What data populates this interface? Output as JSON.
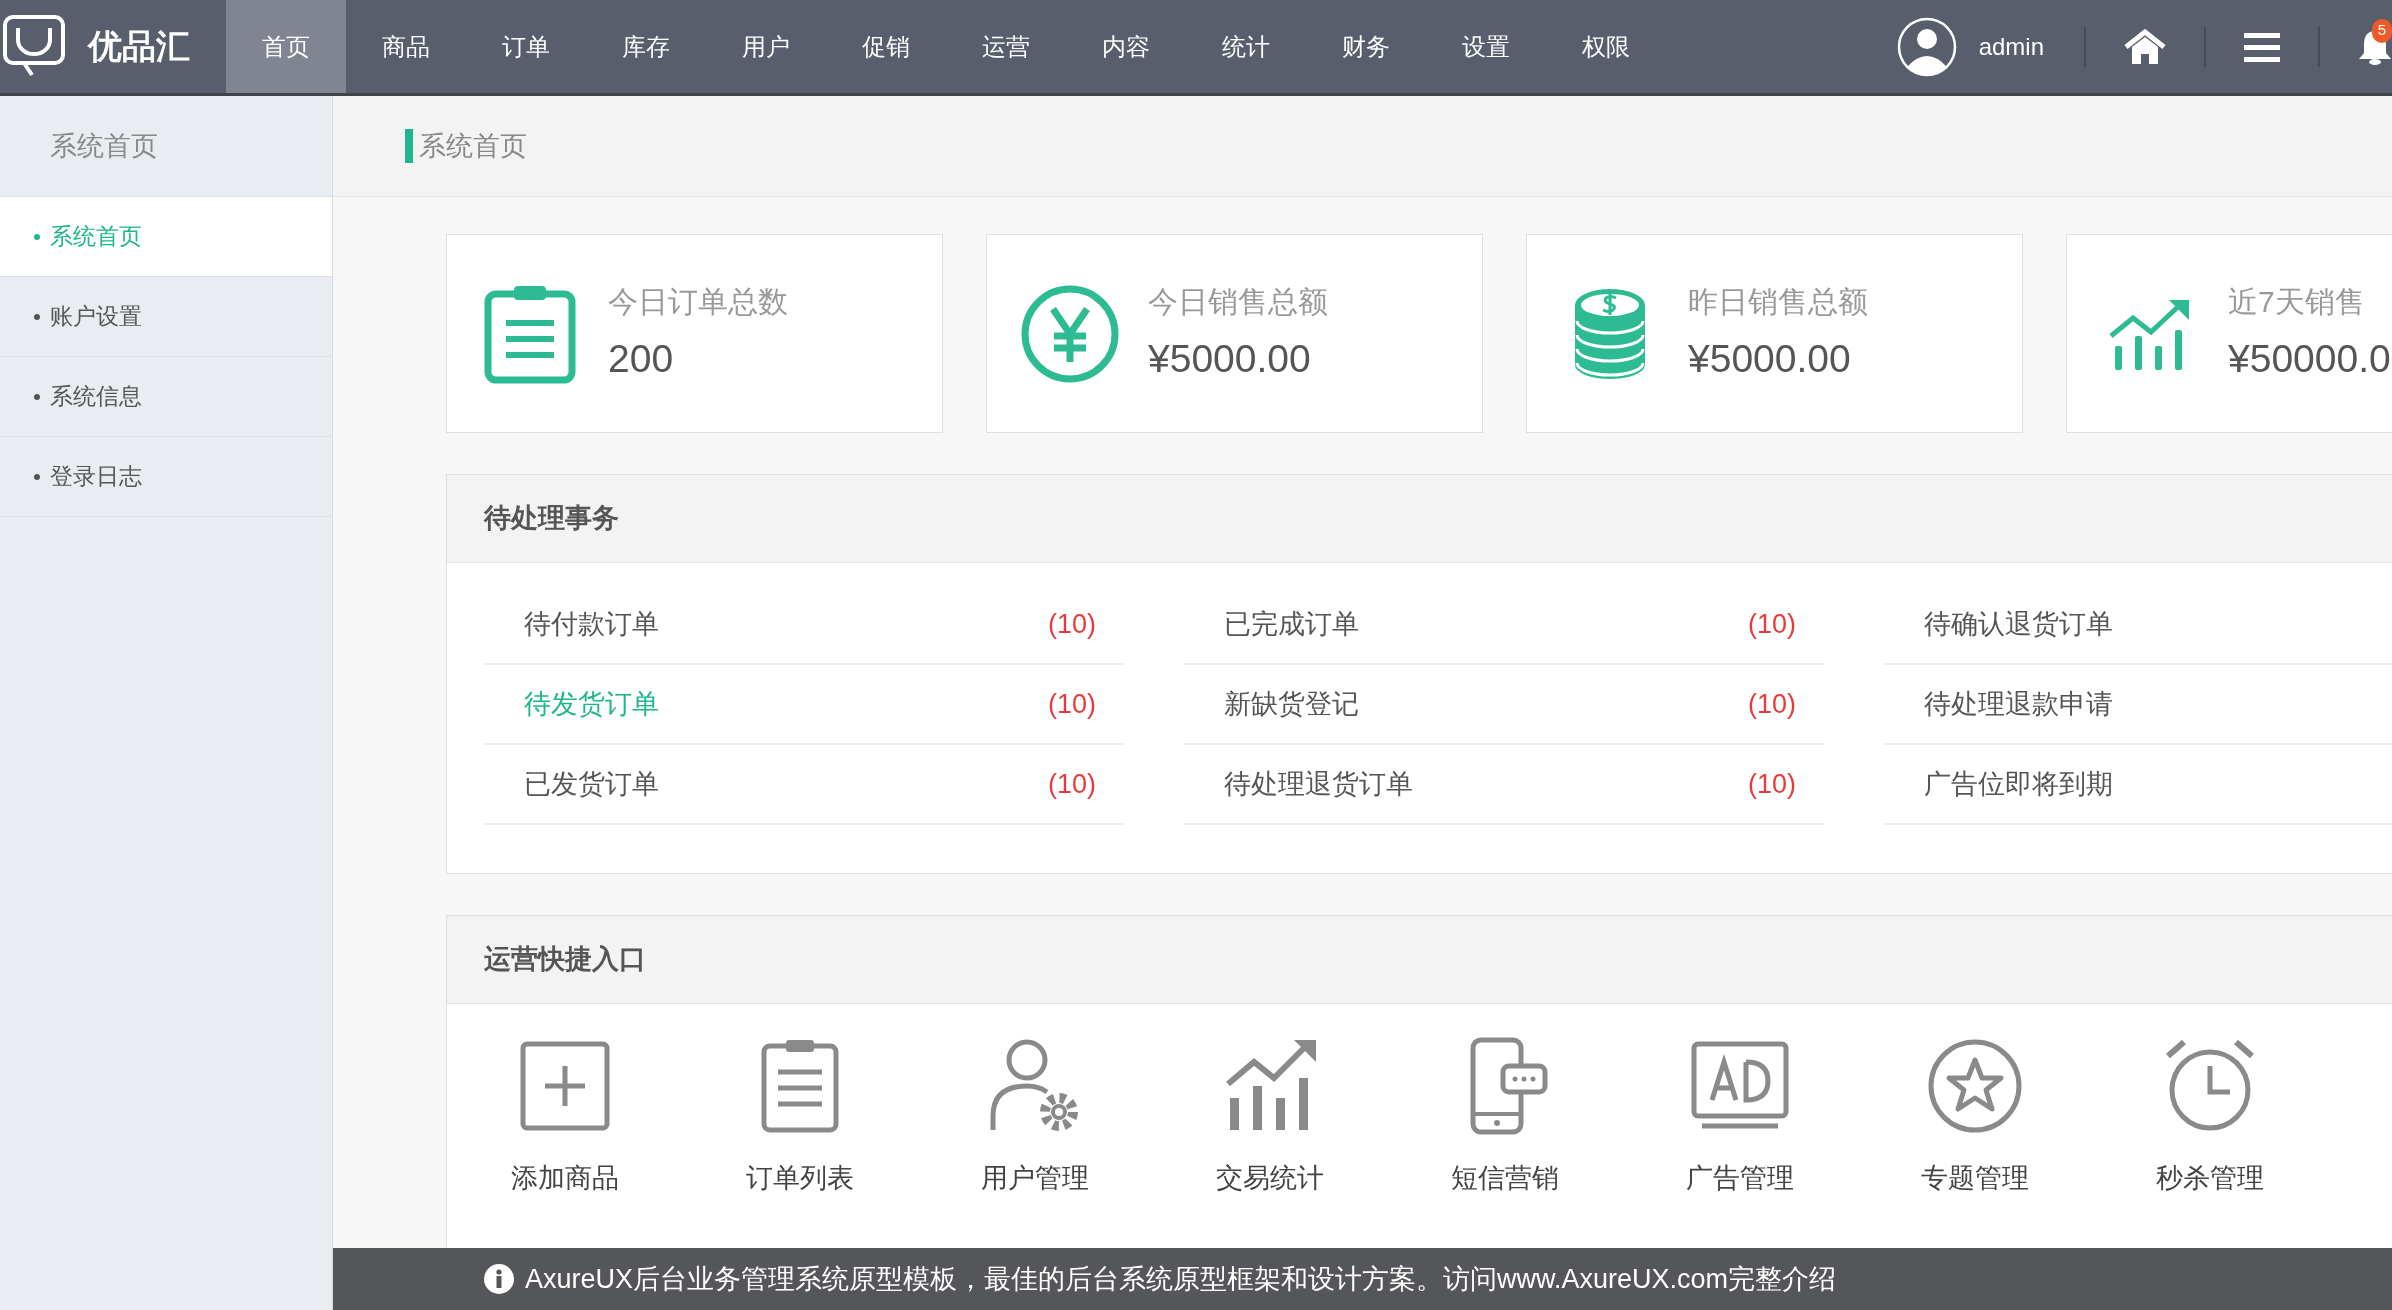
{
  "brand": "优品汇",
  "nav": [
    {
      "label": "首页",
      "selected": true
    },
    {
      "label": "商品",
      "selected": false
    },
    {
      "label": "订单",
      "selected": false
    },
    {
      "label": "库存",
      "selected": false
    },
    {
      "label": "用户",
      "selected": false
    },
    {
      "label": "促销",
      "selected": false
    },
    {
      "label": "运营",
      "selected": false
    },
    {
      "label": "内容",
      "selected": false
    },
    {
      "label": "统计",
      "selected": false
    },
    {
      "label": "财务",
      "selected": false
    },
    {
      "label": "设置",
      "selected": false
    },
    {
      "label": "权限",
      "selected": false
    }
  ],
  "user": {
    "name": "admin",
    "notifications": "5"
  },
  "sidebar": {
    "title": "系统首页",
    "items": [
      {
        "label": "系统首页",
        "selected": true
      },
      {
        "label": "账户设置",
        "selected": false
      },
      {
        "label": "系统信息",
        "selected": false
      },
      {
        "label": "登录日志",
        "selected": false
      }
    ]
  },
  "breadcrumb": "系统首页",
  "stats": [
    {
      "label": "今日订单总数",
      "value": "200"
    },
    {
      "label": "今日销售总额",
      "value": "¥5000.00"
    },
    {
      "label": "昨日销售总额",
      "value": "¥5000.00"
    },
    {
      "label": "近7天销售",
      "value": "¥50000.0"
    }
  ],
  "pending": {
    "title": "待处理事务",
    "columns": [
      [
        {
          "label": "待付款订单",
          "count": "(10)",
          "selected": false
        },
        {
          "label": "待发货订单",
          "count": "(10)",
          "selected": true
        },
        {
          "label": "已发货订单",
          "count": "(10)",
          "selected": false
        }
      ],
      [
        {
          "label": "已完成订单",
          "count": "(10)",
          "selected": false
        },
        {
          "label": "新缺货登记",
          "count": "(10)",
          "selected": false
        },
        {
          "label": "待处理退货订单",
          "count": "(10)",
          "selected": false
        }
      ],
      [
        {
          "label": "待确认退货订单",
          "selected": false
        },
        {
          "label": "待处理退款申请",
          "selected": false
        },
        {
          "label": "广告位即将到期",
          "selected": false
        }
      ]
    ]
  },
  "shortcuts": {
    "title": "运营快捷入口",
    "items": [
      "添加商品",
      "订单列表",
      "用户管理",
      "交易统计",
      "短信营销",
      "广告管理",
      "专题管理",
      "秒杀管理"
    ]
  },
  "notice": "AxureUX后台业务管理系统原型模板，最佳的后台系统原型框架和设计方案。访问www.AxureUX.com完整介绍"
}
